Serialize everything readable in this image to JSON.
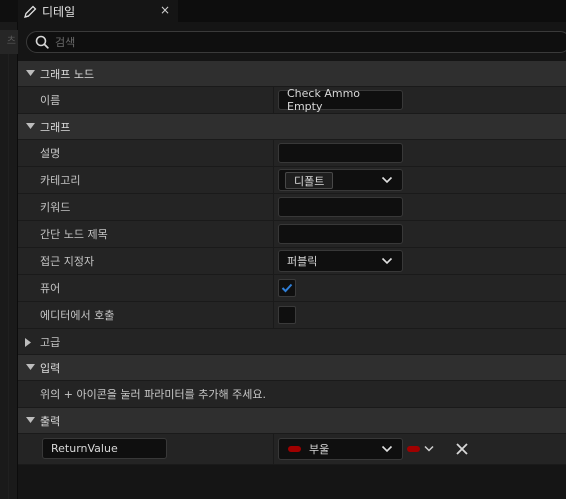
{
  "left_fragment": "츠",
  "tab": {
    "title": "디테일",
    "close": "×"
  },
  "search": {
    "placeholder": "검색"
  },
  "sections": {
    "graph_node": {
      "label": "그래프 노드",
      "name_label": "이름",
      "name_value": "Check Ammo Empty"
    },
    "graph": {
      "label": "그래프",
      "description_label": "설명",
      "category_label": "카테고리",
      "category_value": "디폴트",
      "keywords_label": "키워드",
      "compact_title_label": "간단 노드 제목",
      "access_label": "접근 지정자",
      "access_value": "퍼블릭",
      "pure_label": "퓨어",
      "pure_checked": true,
      "call_in_editor_label": "에디터에서 호출",
      "call_in_editor_checked": false
    },
    "advanced": {
      "label": "고급"
    },
    "inputs": {
      "label": "입력",
      "hint": "위의 + 아이콘을 눌러 파라미터를 추가해 주세요."
    },
    "outputs": {
      "label": "출력",
      "param_name": "ReturnValue",
      "param_type": "부울"
    }
  },
  "colors": {
    "checkbox_accent": "#2f7fd8",
    "bool_pin": "#a00000"
  },
  "icons": [
    "pencil-icon",
    "close-icon",
    "search-icon",
    "chevron-down-icon",
    "triangle-right-icon",
    "checkmark-icon",
    "remove-icon"
  ]
}
